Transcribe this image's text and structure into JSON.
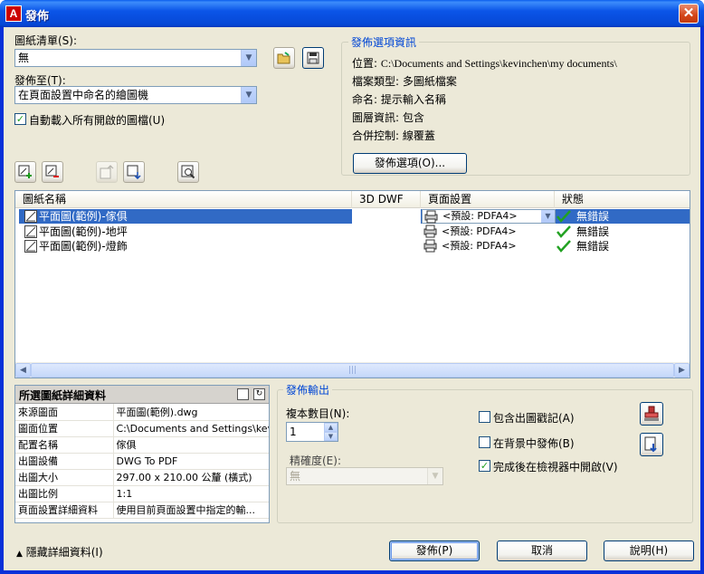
{
  "window": {
    "title": "發佈",
    "app_icon_text": "A",
    "close_glyph": "✕"
  },
  "sheet_list": {
    "label": "圖紙清單(S):",
    "value": "無"
  },
  "publish_to": {
    "label": "發佈至(T):",
    "value": "在頁面設置中命名的繪圖機"
  },
  "auto_load": {
    "label": "自動載入所有開啟的圖檔(U)",
    "checked": true
  },
  "options_info": {
    "title": "發佈選項資訊",
    "rows": [
      {
        "key": "位置:",
        "value": "C:\\Documents and Settings\\kevinchen\\my documents\\"
      },
      {
        "key": "檔案類型:",
        "value": "多圖紙檔案"
      },
      {
        "key": "命名:",
        "value": "提示輸入名稱"
      },
      {
        "key": "圖層資訊:",
        "value": "包含"
      },
      {
        "key": "合併控制:",
        "value": "線覆蓋"
      }
    ],
    "button": "發佈選項(O)..."
  },
  "list": {
    "columns": [
      "圖紙名稱",
      "3D DWF",
      "頁面設置",
      "狀態"
    ],
    "rows": [
      {
        "name": "平面圖(範例)-傢俱",
        "page_setup": "<預設: PDFA4>",
        "status": "無錯誤",
        "selected": true
      },
      {
        "name": "平面圖(範例)-地坪",
        "page_setup": "<預設: PDFA4>",
        "status": "無錯誤",
        "selected": false
      },
      {
        "name": "平面圖(範例)-燈飾",
        "page_setup": "<預設: PDFA4>",
        "status": "無錯誤",
        "selected": false
      }
    ]
  },
  "details": {
    "title": "所選圖紙詳細資料",
    "rows": [
      {
        "key": "來源圖面",
        "value": "平面圖(範例).dwg"
      },
      {
        "key": "圖面位置",
        "value": "C:\\Documents and Settings\\kevinc..."
      },
      {
        "key": "配置名稱",
        "value": "傢俱"
      },
      {
        "key": "出圖設備",
        "value": "DWG To PDF"
      },
      {
        "key": "出圖大小",
        "value": "297.00 x 210.00 公釐 (橫式)"
      },
      {
        "key": "出圖比例",
        "value": "1:1"
      },
      {
        "key": "頁面設置詳細資料",
        "value": "使用目前頁面設置中指定的輸..."
      }
    ]
  },
  "output": {
    "title": "發佈輸出",
    "copies_label": "複本數目(N):",
    "copies_value": "1",
    "precision_label": "精確度(E):",
    "precision_value": "無",
    "include_stamp": {
      "label": "包含出圖戳記(A)",
      "checked": false
    },
    "background": {
      "label": "在背景中發佈(B)",
      "checked": false
    },
    "open_viewer": {
      "label": "完成後在檢視器中開啟(V)",
      "checked": true
    }
  },
  "footer": {
    "hide_details": "隱藏詳細資料(I)",
    "publish": "發佈(P)",
    "cancel": "取消",
    "help": "說明(H)"
  },
  "colors": {
    "selection": "#316ac5",
    "title_blue": "#0046d5",
    "ok_green": "#21a121"
  }
}
